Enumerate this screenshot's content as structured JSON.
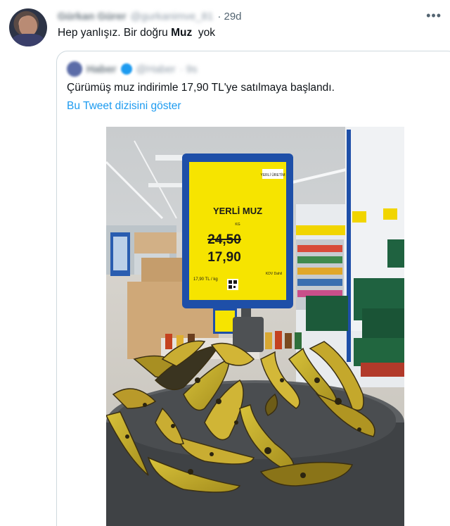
{
  "tweet": {
    "author_name": "Gürkan Gürer",
    "author_handle": "@gurkanimve_81",
    "time": "· 29d",
    "more_icon": "more-icon",
    "text_before": "Hep yanlışız. Bir doğru ",
    "text_bold": "Muz",
    "text_after": "  yok"
  },
  "quote": {
    "author_name": "Haber",
    "author_handle": "@Haber",
    "time": "· 9s",
    "text": "Çürümüş muz indirimle 17,90 TL'ye satılmaya başlandı.",
    "thread_link": "Bu Tweet dizisini göster"
  },
  "photo": {
    "sign_brand": "YERLİ ÜRETİM",
    "sign_product": "YERLİ MUZ",
    "sign_unit": "KG",
    "old_price": "24,50",
    "new_price": "17,90",
    "unit_price": "17,90 TL / kg",
    "kdv": "KDV Dahil",
    "colors": {
      "sign_yellow": "#f6e400",
      "sign_frame": "#1e4fa8"
    }
  }
}
